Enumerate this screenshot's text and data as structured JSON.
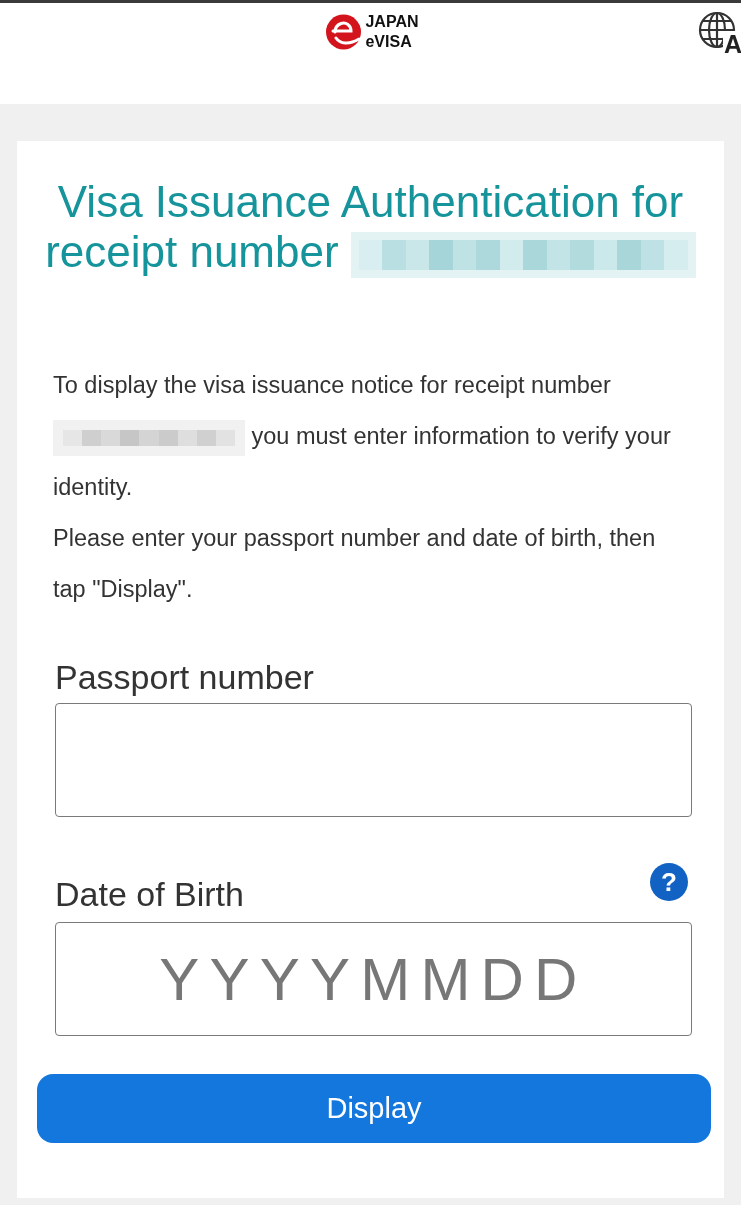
{
  "header": {
    "logo_lines": [
      "JAPAN",
      "eVISA"
    ],
    "language_button": {
      "label": "A"
    }
  },
  "title": {
    "parts": [
      {
        "kind": "text",
        "text": "Visa Issuance Authentication for"
      },
      {
        "kind": "line_break"
      },
      {
        "kind": "text",
        "text": "receipt number"
      },
      {
        "kind": "redaction"
      }
    ]
  },
  "paragraphs": [
    {
      "parts": [
        {
          "kind": "text",
          "text": "To display the visa issuance notice for receipt number"
        },
        {
          "kind": "line_break"
        },
        {
          "kind": "redaction"
        },
        {
          "kind": "text",
          "text": "you must enter information to verify your"
        },
        {
          "kind": "line_break"
        },
        {
          "kind": "text",
          "text": "identity."
        }
      ]
    },
    {
      "parts": [
        {
          "kind": "text",
          "text": "Please enter your passport number and date of birth, then tap \"Display\"."
        }
      ]
    }
  ],
  "fields": [
    {
      "label": "Passport number"
    },
    {
      "label": "Date of Birth",
      "help_label": "?",
      "placeholder": "YYYYMMDD"
    }
  ],
  "submit_button": {
    "label": "Display"
  }
}
